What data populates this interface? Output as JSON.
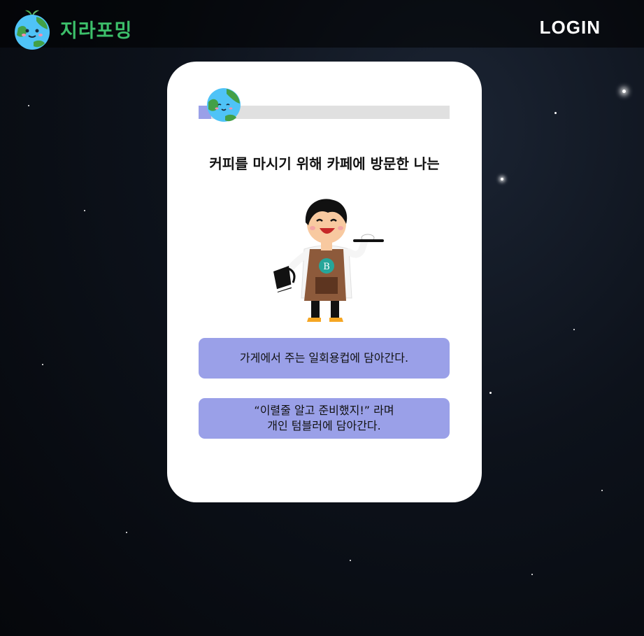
{
  "header": {
    "logo_text": "지라포밍",
    "logo_icon": "earth-mascot-icon",
    "login_label": "LOGIN"
  },
  "quiz": {
    "progress": 0.05,
    "question": "커피를 마시기 위해 카페에 방문한 나는",
    "illustration": "barista-illustration",
    "answers": [
      {
        "lines": [
          "가게에서 주는 일회용컵에 담아간다."
        ]
      },
      {
        "lines": [
          "“이렬줄 알고 준비했지!” 라며",
          "개인 텀블러에 담아간다."
        ]
      }
    ]
  },
  "colors": {
    "brand_green": "#3cbf6a",
    "answer_bg": "#9aa0e8",
    "progress_track": "#e0e0e0"
  }
}
